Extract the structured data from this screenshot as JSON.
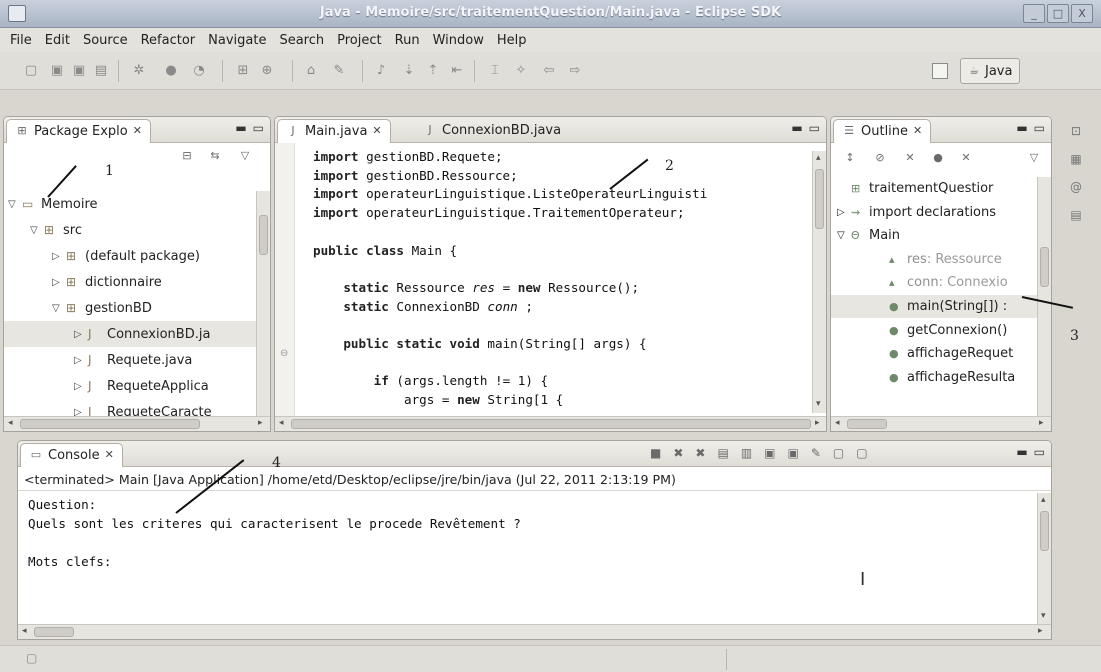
{
  "window": {
    "title": "Java - Memoire/src/traitementQuestion/Main.java - Eclipse SDK",
    "buttons": [
      "_",
      "□",
      "X"
    ]
  },
  "menu": [
    "File",
    "Edit",
    "Source",
    "Refactor",
    "Navigate",
    "Search",
    "Project",
    "Run",
    "Window",
    "Help"
  ],
  "toolbar": {
    "perspective_label": "Java"
  },
  "package_explorer": {
    "tab_label": "Package Explo",
    "tree": [
      {
        "label": "Memoire",
        "depth": 0,
        "twisty": "▽",
        "icon": "project-icon"
      },
      {
        "label": "src",
        "depth": 1,
        "twisty": "▽",
        "icon": "source-folder-icon"
      },
      {
        "label": "(default package)",
        "depth": 2,
        "twisty": "▷",
        "icon": "package-icon"
      },
      {
        "label": "dictionnaire",
        "depth": 2,
        "twisty": "▷",
        "icon": "package-icon"
      },
      {
        "label": "gestionBD",
        "depth": 2,
        "twisty": "▽",
        "icon": "package-icon"
      },
      {
        "label": "ConnexionBD.ja",
        "depth": 3,
        "twisty": "▷",
        "icon": "java-file-icon",
        "selected": true
      },
      {
        "label": "Requete.java",
        "depth": 3,
        "twisty": "▷",
        "icon": "java-file-icon"
      },
      {
        "label": "RequeteApplica",
        "depth": 3,
        "twisty": "▷",
        "icon": "java-file-icon"
      },
      {
        "label": "RequeteCaracte",
        "depth": 3,
        "twisty": "▷",
        "icon": "java-file-icon"
      }
    ]
  },
  "editor": {
    "tabs": [
      {
        "label": "Main.java",
        "active": true
      },
      {
        "label": "ConnexionBD.java",
        "active": false
      }
    ],
    "lines": [
      {
        "segments": [
          {
            "t": "import ",
            "c": "kw"
          },
          {
            "t": "gestionBD.Requete;"
          }
        ]
      },
      {
        "segments": [
          {
            "t": "import ",
            "c": "kw"
          },
          {
            "t": "gestionBD.Ressource;"
          }
        ]
      },
      {
        "segments": [
          {
            "t": "import ",
            "c": "kw"
          },
          {
            "t": "operateurLinguistique.ListeOperateurLinguisti"
          }
        ]
      },
      {
        "segments": [
          {
            "t": "import ",
            "c": "kw"
          },
          {
            "t": "operateurLinguistique.TraitementOperateur;"
          }
        ]
      },
      {
        "segments": []
      },
      {
        "segments": [
          {
            "t": "public class ",
            "c": "kw"
          },
          {
            "t": "Main {"
          }
        ]
      },
      {
        "segments": []
      },
      {
        "segments": [
          {
            "t": "    "
          },
          {
            "t": "static ",
            "c": "kw"
          },
          {
            "t": "Ressource "
          },
          {
            "t": "res",
            "c": "fld"
          },
          {
            "t": " = "
          },
          {
            "t": "new ",
            "c": "kw"
          },
          {
            "t": "Ressource();"
          }
        ]
      },
      {
        "segments": [
          {
            "t": "    "
          },
          {
            "t": "static ",
            "c": "kw"
          },
          {
            "t": "ConnexionBD "
          },
          {
            "t": "conn",
            "c": "fld"
          },
          {
            "t": " ;"
          }
        ]
      },
      {
        "segments": []
      },
      {
        "segments": [
          {
            "t": "    "
          },
          {
            "t": "public static void ",
            "c": "kw"
          },
          {
            "t": "main(String[] args) {"
          }
        ]
      },
      {
        "segments": []
      },
      {
        "segments": [
          {
            "t": "        "
          },
          {
            "t": "if ",
            "c": "kw"
          },
          {
            "t": "(args.length != 1) {"
          }
        ]
      },
      {
        "segments": [
          {
            "t": "            args = "
          },
          {
            "t": "new ",
            "c": "kw"
          },
          {
            "t": "String[1 {"
          }
        ]
      }
    ]
  },
  "outline": {
    "tab_label": "Outline",
    "rows": [
      {
        "label": "traitementQuestior",
        "icon": "package-decl-icon",
        "twisty": ""
      },
      {
        "label": "import declarations",
        "icon": "imports-icon",
        "twisty": "▷"
      },
      {
        "label": "Main",
        "icon": "class-icon",
        "twisty": "▽"
      },
      {
        "label": "res",
        "suffix": " : Ressource",
        "icon": "field-icon",
        "muted": true
      },
      {
        "label": "conn",
        "suffix": " : Connexio",
        "icon": "field-icon",
        "muted": true
      },
      {
        "label": "main(String[]) :",
        "suffix": "",
        "icon": "method-icon",
        "selected": true
      },
      {
        "label": "getConnexion()",
        "suffix": "",
        "icon": "method-icon"
      },
      {
        "label": "affichageRequet",
        "suffix": "",
        "icon": "method-icon"
      },
      {
        "label": "affichageResulta",
        "suffix": "",
        "icon": "method-icon"
      }
    ]
  },
  "console": {
    "tab_label": "Console",
    "header": "<terminated> Main [Java Application] /home/etd/Desktop/eclipse/jre/bin/java (Jul 22, 2011 2:13:19 PM)",
    "lines": [
      "Question:",
      "Quels sont les criteres qui caracterisent le procede Revêtement ?",
      "",
      "Mots clefs:"
    ]
  },
  "annotations": [
    "1",
    "2",
    "3",
    "4"
  ]
}
